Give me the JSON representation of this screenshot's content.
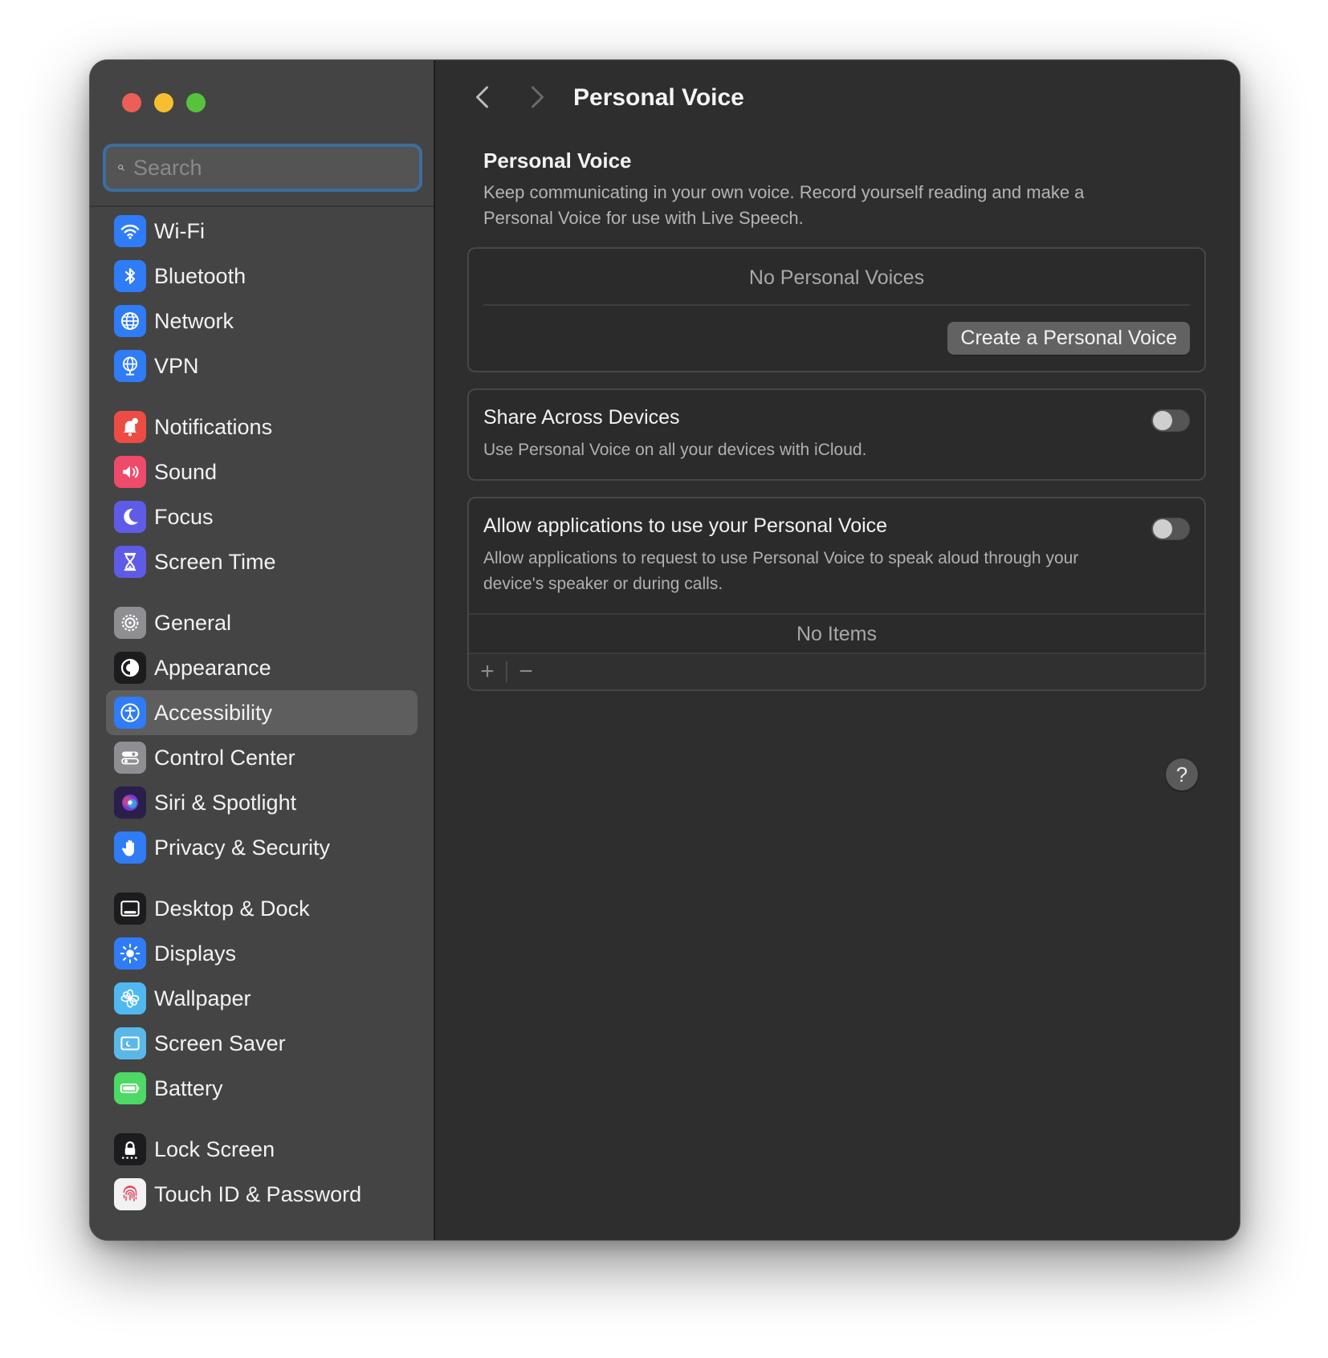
{
  "search": {
    "placeholder": "Search"
  },
  "sidebar": {
    "groups": [
      [
        {
          "label": "Wi-Fi",
          "icon": "wifi-icon",
          "color": "#2f7cf6"
        },
        {
          "label": "Bluetooth",
          "icon": "bluetooth-icon",
          "color": "#2f7cf6"
        },
        {
          "label": "Network",
          "icon": "globe-icon",
          "color": "#2f7cf6"
        },
        {
          "label": "VPN",
          "icon": "vpn-globe-icon",
          "color": "#2f7cf6"
        }
      ],
      [
        {
          "label": "Notifications",
          "icon": "bell-icon",
          "color": "#ec4c43"
        },
        {
          "label": "Sound",
          "icon": "speaker-icon",
          "color": "#ee4a6a"
        },
        {
          "label": "Focus",
          "icon": "moon-icon",
          "color": "#5e5ce6"
        },
        {
          "label": "Screen Time",
          "icon": "hourglass-icon",
          "color": "#5e5ce6"
        }
      ],
      [
        {
          "label": "General",
          "icon": "gear-icon",
          "color": "#8e8e93"
        },
        {
          "label": "Appearance",
          "icon": "appearance-icon",
          "color": "#1c1c1e"
        },
        {
          "label": "Accessibility",
          "icon": "accessibility-icon",
          "color": "#2f7cf6",
          "selected": true
        },
        {
          "label": "Control Center",
          "icon": "control-center-icon",
          "color": "#8e8e93"
        },
        {
          "label": "Siri & Spotlight",
          "icon": "siri-icon",
          "color": "#2a1f4a"
        },
        {
          "label": "Privacy & Security",
          "icon": "hand-icon",
          "color": "#2f7cf6"
        }
      ],
      [
        {
          "label": "Desktop & Dock",
          "icon": "dock-icon",
          "color": "#1c1c1e"
        },
        {
          "label": "Displays",
          "icon": "sun-icon",
          "color": "#2f7cf6"
        },
        {
          "label": "Wallpaper",
          "icon": "flower-icon",
          "color": "#4fb8f0"
        },
        {
          "label": "Screen Saver",
          "icon": "screensaver-icon",
          "color": "#5ab8e8"
        },
        {
          "label": "Battery",
          "icon": "battery-icon",
          "color": "#4cd964"
        }
      ],
      [
        {
          "label": "Lock Screen",
          "icon": "lock-icon",
          "color": "#1c1c1e"
        },
        {
          "label": "Touch ID & Password",
          "icon": "fingerprint-icon",
          "color": "#f2f2f2"
        }
      ]
    ]
  },
  "toolbar": {
    "title": "Personal Voice"
  },
  "personal_voice": {
    "title": "Personal Voice",
    "description": "Keep communicating in your own voice. Record yourself reading and make a Personal Voice for use with Live Speech.",
    "empty_label": "No Personal Voices",
    "create_button": "Create a Personal Voice"
  },
  "share": {
    "title": "Share Across Devices",
    "description": "Use Personal Voice on all your devices with iCloud.",
    "enabled": false
  },
  "allow_apps": {
    "title": "Allow applications to use your Personal Voice",
    "description": "Allow applications to request to use Personal Voice to speak aloud through your device's speaker or during calls.",
    "enabled": false,
    "empty_label": "No Items",
    "add_label": "+",
    "remove_label": "−"
  },
  "help": {
    "label": "?"
  }
}
